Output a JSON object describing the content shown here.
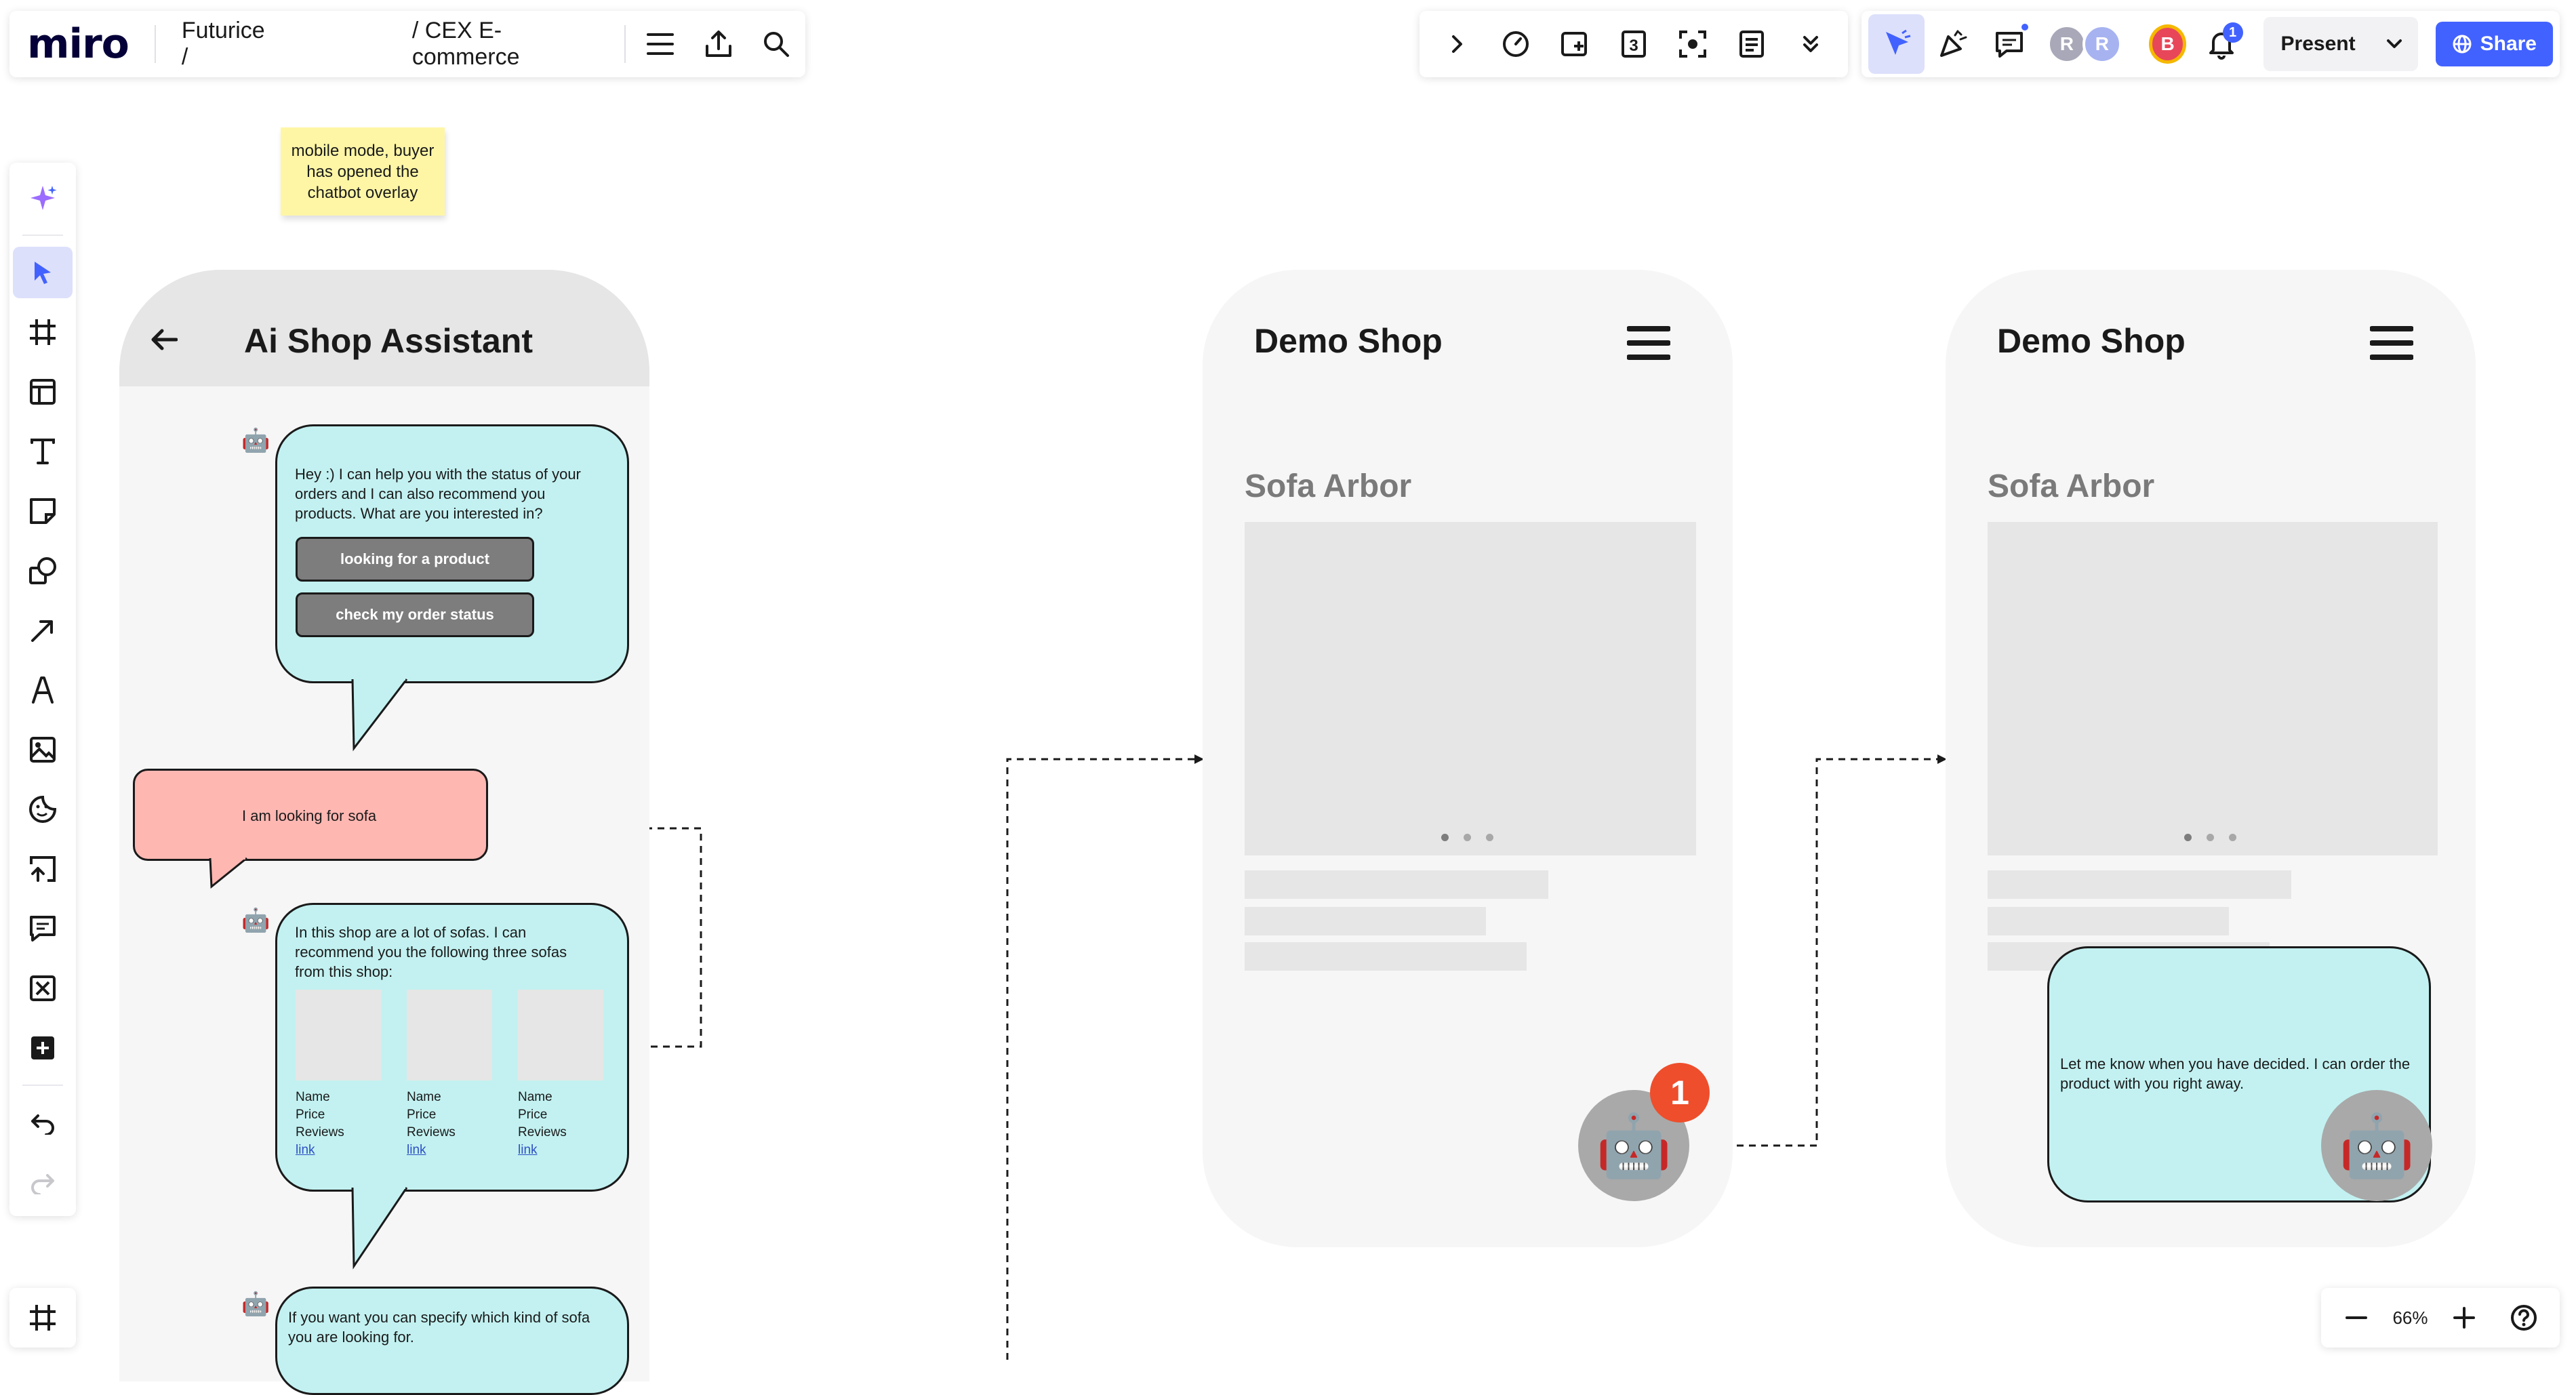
{
  "app": {
    "logo": "miro",
    "breadcrumb_workspace": "Futurice /",
    "breadcrumb_board": "/ CEX E-commerce"
  },
  "topbar": {
    "present_label": "Present",
    "share_label": "Share",
    "notification_count": "1",
    "collaborators": [
      {
        "initial": "R",
        "color": "#a8a8b8"
      },
      {
        "initial": "R",
        "color": "#a7b3f0"
      },
      {
        "initial": "B",
        "color": "#e8475a"
      }
    ],
    "timer_icon_label": "3"
  },
  "zoom": {
    "level": "66%"
  },
  "canvas": {
    "sticky_note": "mobile mode, buyer has opened the chatbot overlay",
    "assistant_screen": {
      "title": "Ai Shop Assistant",
      "bot_msg_1": "Hey :) I can help you with the status of your orders and I can also recommend you products. What are you interested in?",
      "option_1": "looking for a product",
      "option_2": "check my order status",
      "user_msg_1": "I am looking for sofa",
      "bot_msg_2": "In this shop are a lot of sofas. I can recommend you the following three sofas from this shop:",
      "products": [
        {
          "name": "Name",
          "price": "Price",
          "reviews": "Reviews",
          "link": "link"
        },
        {
          "name": "Name",
          "price": "Price",
          "reviews": "Reviews",
          "link": "link"
        },
        {
          "name": "Name",
          "price": "Price",
          "reviews": "Reviews",
          "link": "link"
        }
      ],
      "bot_msg_3": "If you want you can specify which kind of sofa you are looking for."
    },
    "shop_screen_1": {
      "title": "Demo Shop",
      "product_title": "Sofa Arbor",
      "badge": "1"
    },
    "shop_screen_2": {
      "title": "Demo Shop",
      "product_title": "Sofa Arbor",
      "chat_msg": "Let me know when you have decided. I can order the product with you right away."
    }
  }
}
